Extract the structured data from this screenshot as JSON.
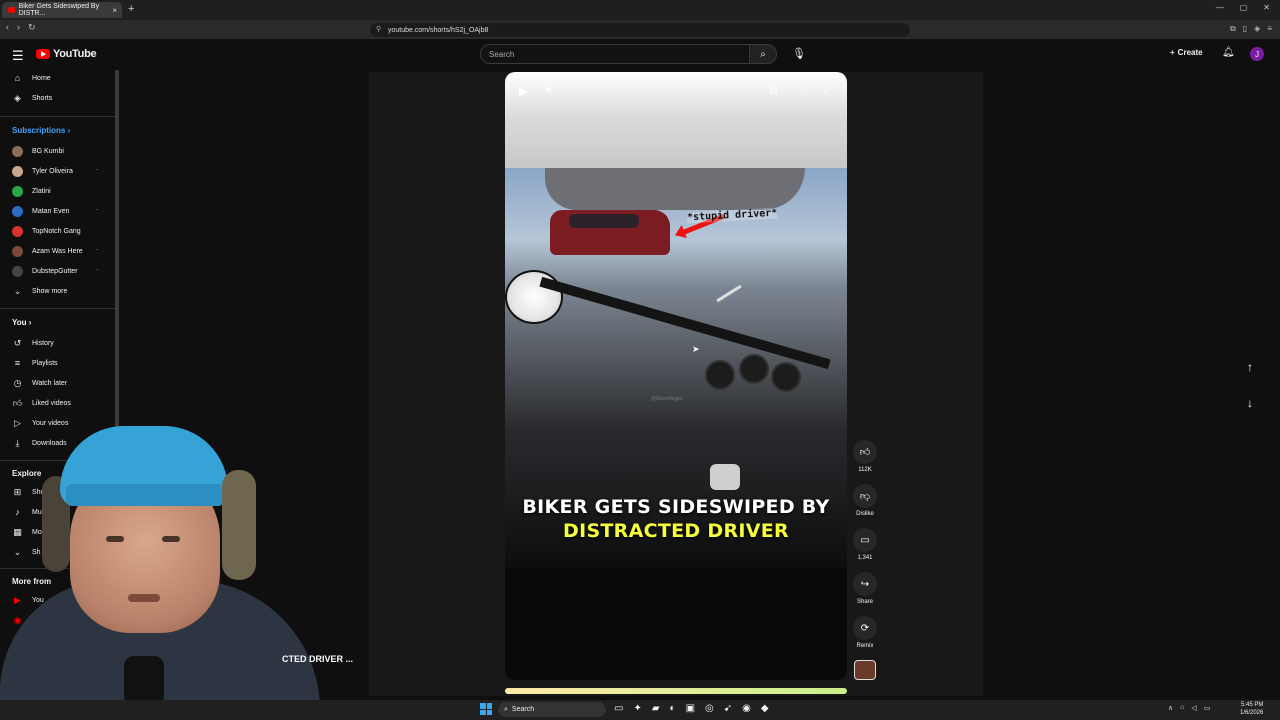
{
  "browser": {
    "tab_title": "Biker Gets Sideswiped By DISTR...",
    "tab_close": "×",
    "new_tab": "+",
    "url": "youtube.com/shorts/hS2j_OAjb8",
    "window_controls": [
      "—",
      "▢",
      "✕"
    ]
  },
  "header": {
    "logo_text": "YouTube",
    "search_placeholder": "Search",
    "create_label": "Create",
    "avatar_letter": "J"
  },
  "sidebar": {
    "main": [
      {
        "label": "Home",
        "icon": "home-icon"
      },
      {
        "label": "Shorts",
        "icon": "shorts-icon"
      }
    ],
    "subscriptions_heading": "Subscriptions",
    "subscriptions": [
      {
        "label": "BG Kumbi",
        "color": "#8a6d5a",
        "live": false
      },
      {
        "label": "Tyler Oliveira",
        "color": "#c9a88f",
        "live": true
      },
      {
        "label": "Zlatini",
        "color": "#29a84a",
        "live": false
      },
      {
        "label": "Matan Even",
        "color": "#2b6cc4",
        "live": true
      },
      {
        "label": "TopNotch Gang",
        "color": "#d8322e",
        "live": false
      },
      {
        "label": "Azam Was Here",
        "color": "#7a4b3a",
        "live": true
      },
      {
        "label": "DubstepGutter",
        "color": "#444444",
        "live": true
      }
    ],
    "show_more": "Show more",
    "you_heading": "You",
    "you_items": [
      {
        "label": "History",
        "icon": "history-icon"
      },
      {
        "label": "Playlists",
        "icon": "playlists-icon"
      },
      {
        "label": "Watch later",
        "icon": "watch-later-icon"
      },
      {
        "label": "Liked videos",
        "icon": "liked-videos-icon"
      },
      {
        "label": "Your videos",
        "icon": "your-videos-icon"
      },
      {
        "label": "Downloads",
        "icon": "downloads-icon"
      }
    ],
    "explore_heading": "Explore",
    "explore_items": [
      {
        "label": "Shoppin",
        "icon": "shopping-icon"
      },
      {
        "label": "Music",
        "icon": "music-icon"
      },
      {
        "label": "Mov",
        "icon": "movies-icon"
      },
      {
        "label": "Sh",
        "icon": "show-more-icon"
      }
    ],
    "more_from_heading": "More from",
    "more_from_items": [
      "You",
      "Yo",
      ""
    ]
  },
  "short": {
    "caption_line1": "BIKER GETS SIDESWIPED BY",
    "caption_line2": "DISTRACTED DRIVER",
    "annotation": "*stupid driver*",
    "watermark": "@BikerMegler",
    "overlay_title": "CTED DRIVER ..."
  },
  "actions": {
    "like_count": "112K",
    "dislike_label": "Dislike",
    "comment_count": "1,341",
    "share_label": "Share",
    "remix_label": "Remix"
  },
  "taskbar": {
    "search_label": "Search",
    "time": "5:45 PM",
    "date": "1/6/2026"
  },
  "colors": {
    "accent": "#ff0000",
    "link_blue": "#3ea6ff",
    "caption_yellow": "#f7ff3a",
    "avatar": "#7b1fa2"
  }
}
